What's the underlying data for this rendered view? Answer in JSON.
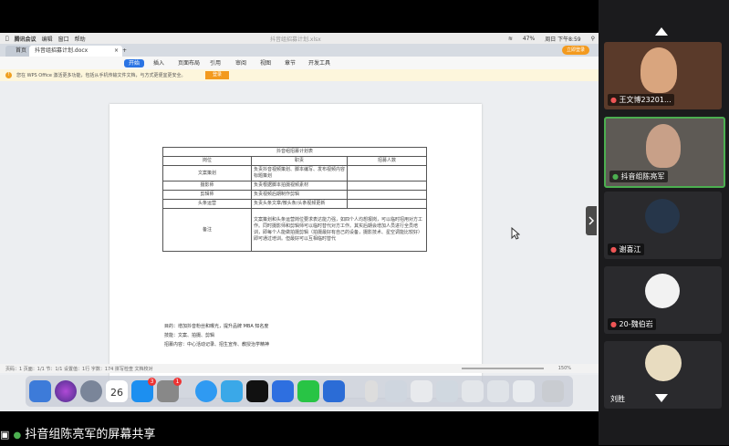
{
  "mac_menu": {
    "app": "腾讯会议",
    "items": [
      "编辑",
      "窗口",
      "帮助"
    ],
    "window_title": "抖音组招募计划.xlsx",
    "status": {
      "battery": "47%",
      "clock": "周日 下午8:59"
    }
  },
  "wps": {
    "tabs": {
      "home": "首页",
      "doc": "抖音组招募计划.docx",
      "add": "+"
    },
    "login_label": "立即登录",
    "ribbon": [
      "开始",
      "插入",
      "页面布局",
      "引用",
      "审阅",
      "视图",
      "章节",
      "开发工具"
    ],
    "notice": {
      "icon": "!",
      "text": "您在 WPS Office 激活更多功能，包括从手机传输文件文档，与方式更便宜更安全。",
      "button": "登录"
    }
  },
  "doc": {
    "title": "抖音组招募计划表",
    "headers": [
      "岗位",
      "职责",
      "招募人数"
    ],
    "rows": [
      {
        "role": "文案策划",
        "duty": "负责抖音视频策划、脚本编写、发布视频内容标题策划"
      },
      {
        "role": "摄影师",
        "duty": "负责根据脚本拍摄视频素材"
      },
      {
        "role": "剪辑师",
        "duty": "负责视频后期制作剪辑"
      },
      {
        "role": "头条运营",
        "duty": "负责头条文章/微头条/头条视频更新"
      },
      {
        "role": "备注",
        "duty": "文案策划和头条运营岗位要求表达能力强，如四个人均想报岗，可以临时招用对方工作。同时摄影师和剪辑师可以临时替代对方工作。其实后期会增加人员进行全员培训，即每个人能做拍摄剪辑（拍摄最好有自己的设备，摄影技术、星空调能比较好）即可通过培训。但最好可以互相临时替代"
      }
    ],
    "notes": [
      "目的：增加抖音粉丝和曝光，提升品牌 MBA 知名度",
      "技能：文案、拍摄、剪辑",
      "招募内容：中心活动记录、招生宣传、教授治学精神"
    ]
  },
  "status_bar": {
    "left": "页码：1  页面：1/1  节：1/1  设置值：1行  字数：174  拼写检查  文档校对",
    "zoom": "150%"
  },
  "dock": {
    "calendar_day": "26",
    "badge_a": "3",
    "badge_b": "1"
  },
  "participants": [
    {
      "name": "王文博23201..."
    },
    {
      "name": "抖音组陈亮军"
    },
    {
      "name": "谢喜江"
    },
    {
      "name": "20-魏伯岩"
    },
    {
      "name": "刘胜"
    }
  ],
  "caption": "抖音组陈亮军的屏幕共享",
  "colors": {
    "accent": "#2b74e4",
    "login": "#f39a1e",
    "speaker_border": "#4caf50"
  }
}
